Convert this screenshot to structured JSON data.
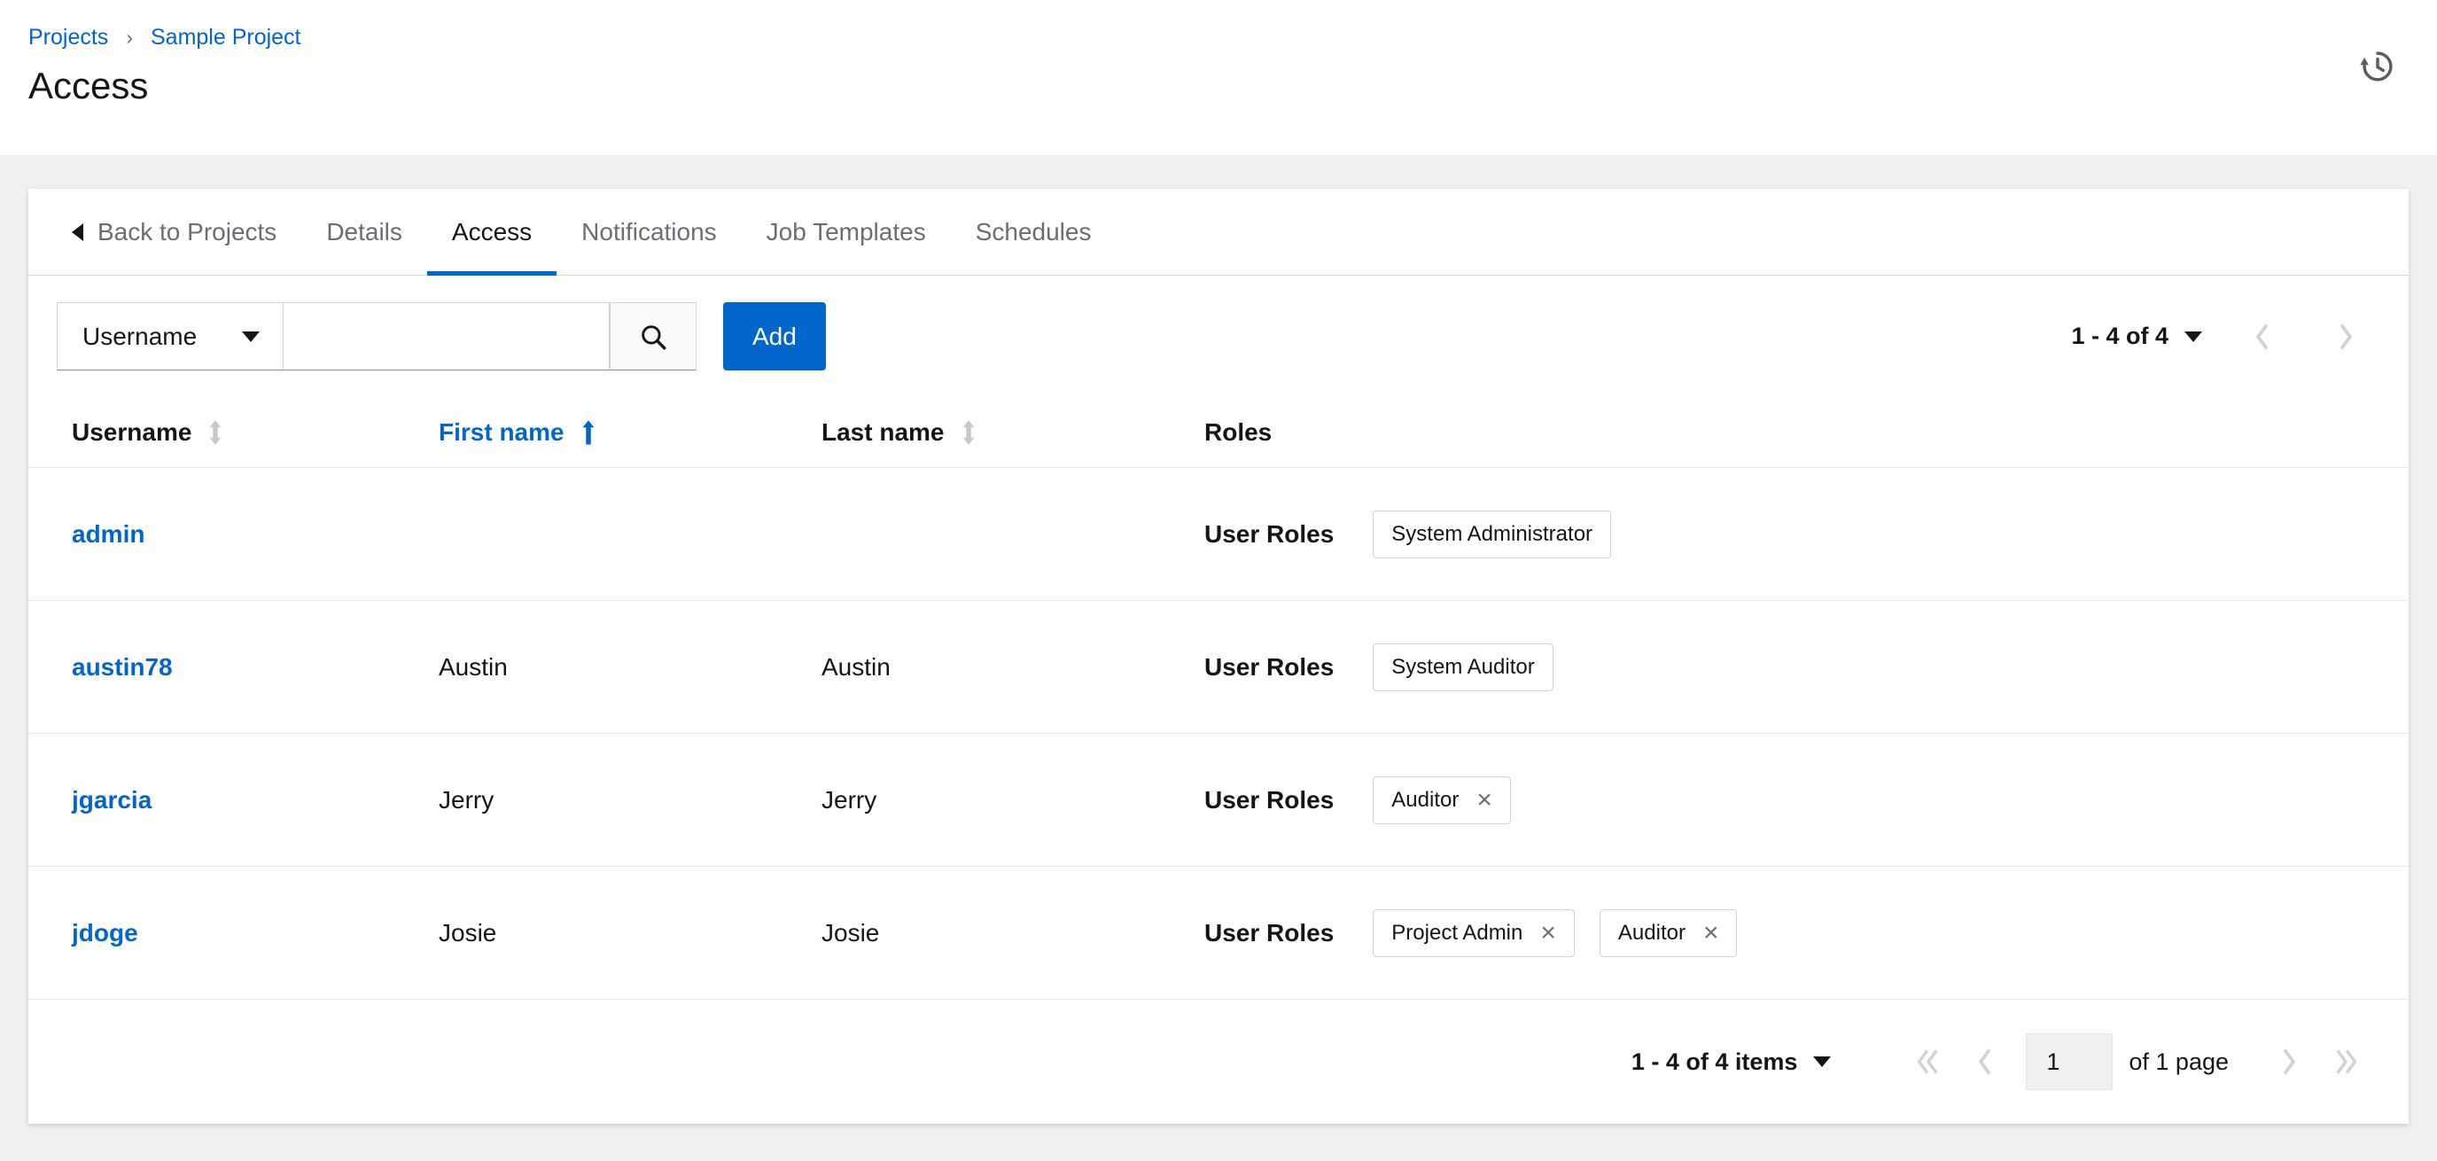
{
  "colors": {
    "primary": "#0066cc",
    "text": "#151515",
    "muted": "#6a6e73",
    "disabled": "#d2d2d2",
    "page_background": "#f0f0f0"
  },
  "icons": {
    "history": "↺",
    "search": "⌕",
    "caret_down": "▾",
    "back": "◀",
    "sort_unsorted": "⇅",
    "sort_ascending": "↑",
    "chevron_left": "‹",
    "chevron_right": "›",
    "first_page": "«",
    "last_page": "»",
    "close": "×"
  },
  "breadcrumb": {
    "separator": "›",
    "items": [
      {
        "label": "Projects"
      },
      {
        "label": "Sample Project"
      }
    ]
  },
  "page_title": "Access",
  "tabs": {
    "back_label": "Back to Projects",
    "items": [
      {
        "label": "Details",
        "active": false
      },
      {
        "label": "Access",
        "active": true
      },
      {
        "label": "Notifications",
        "active": false
      },
      {
        "label": "Job Templates",
        "active": false
      },
      {
        "label": "Schedules",
        "active": false
      }
    ]
  },
  "toolbar": {
    "filter_selected": "Username",
    "search_value": "",
    "add_label": "Add",
    "pagination_summary": "1 - 4 of 4"
  },
  "table": {
    "columns": [
      {
        "label": "Username",
        "sort": "none"
      },
      {
        "label": "First name",
        "sort": "ascending"
      },
      {
        "label": "Last name",
        "sort": "none"
      },
      {
        "label": "Roles",
        "sort": null
      }
    ],
    "roles_row_label": "User Roles",
    "rows": [
      {
        "username": "admin",
        "first_name": "",
        "last_name": "",
        "roles": [
          {
            "name": "System Administrator",
            "removable": false
          }
        ]
      },
      {
        "username": "austin78",
        "first_name": "Austin",
        "last_name": "Austin",
        "roles": [
          {
            "name": "System Auditor",
            "removable": false
          }
        ]
      },
      {
        "username": "jgarcia",
        "first_name": "Jerry",
        "last_name": "Jerry",
        "roles": [
          {
            "name": "Auditor",
            "removable": true
          }
        ]
      },
      {
        "username": "jdoge",
        "first_name": "Josie",
        "last_name": "Josie",
        "roles": [
          {
            "name": "Project Admin",
            "removable": true
          },
          {
            "name": "Auditor",
            "removable": true
          }
        ]
      }
    ]
  },
  "footer": {
    "items_summary": "1 - 4 of 4 items",
    "current_page": "1",
    "page_count_label": "of 1 page"
  }
}
